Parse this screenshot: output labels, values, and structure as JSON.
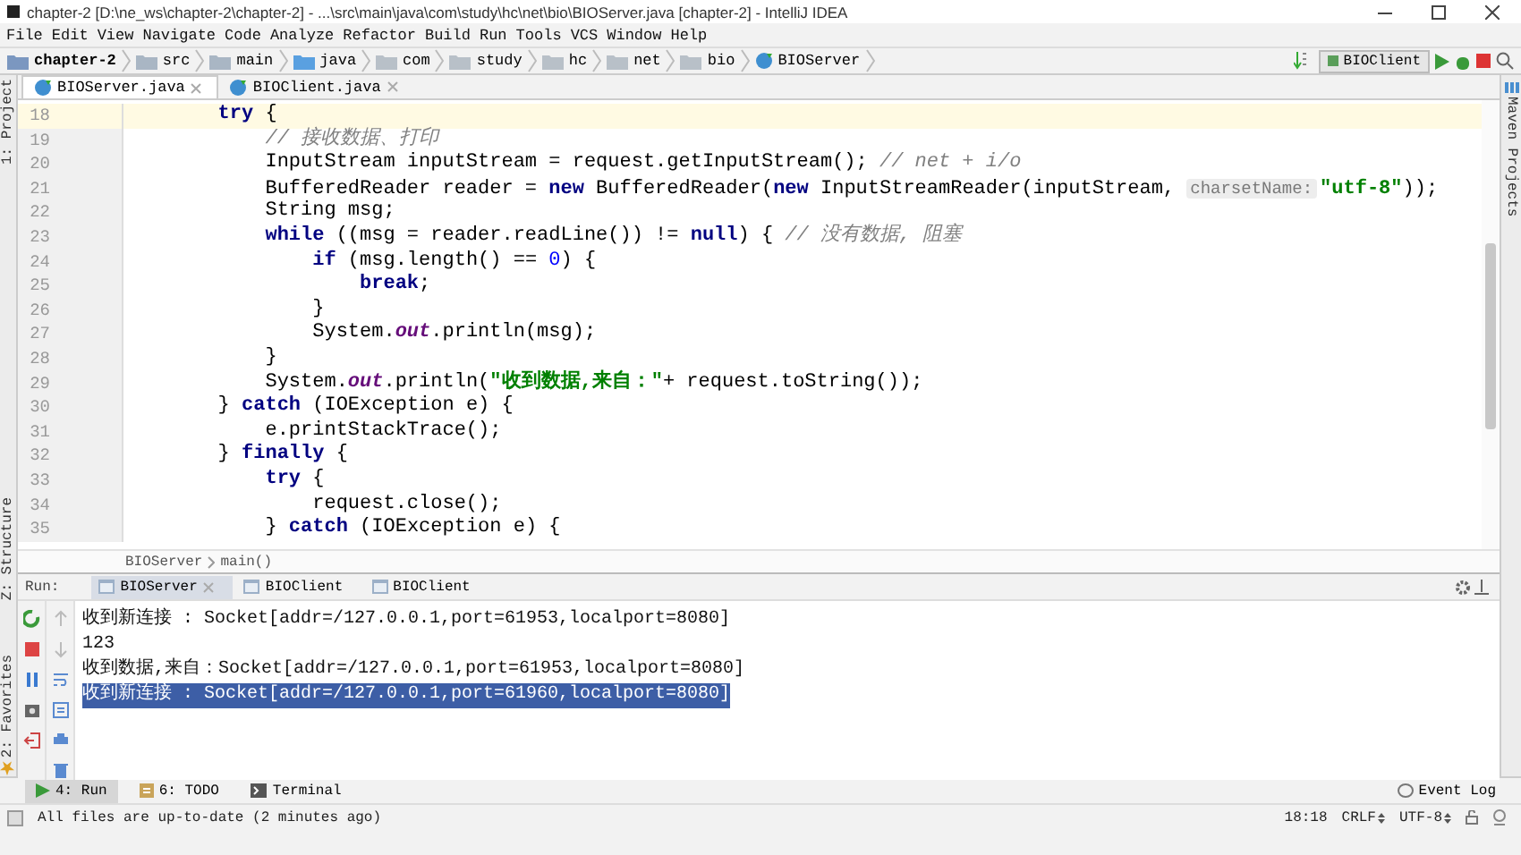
{
  "window": {
    "title": "chapter-2 [D:\\ne_ws\\chapter-2\\chapter-2] - ...\\src\\main\\java\\com\\study\\hc\\net\\bio\\BIOServer.java [chapter-2] - IntelliJ IDEA"
  },
  "menu": [
    "File",
    "Edit",
    "View",
    "Navigate",
    "Code",
    "Analyze",
    "Refactor",
    "Build",
    "Run",
    "Tools",
    "VCS",
    "Window",
    "Help"
  ],
  "nav": {
    "crumbs": [
      {
        "text": "chapter-2",
        "kind": "module"
      },
      {
        "text": "src",
        "kind": "folder"
      },
      {
        "text": "main",
        "kind": "folder"
      },
      {
        "text": "java",
        "kind": "source"
      },
      {
        "text": "com",
        "kind": "package"
      },
      {
        "text": "study",
        "kind": "package"
      },
      {
        "text": "hc",
        "kind": "package"
      },
      {
        "text": "net",
        "kind": "package"
      },
      {
        "text": "bio",
        "kind": "package"
      },
      {
        "text": "BIOServer",
        "kind": "class"
      }
    ],
    "run_config": "BIOClient"
  },
  "side_tools": {
    "left": [
      "1: Project",
      "Z: Structure",
      "2: Favorites"
    ],
    "right": [
      "Maven Projects"
    ]
  },
  "editor": {
    "tabs": [
      {
        "label": "BIOServer.java",
        "selected": true
      },
      {
        "label": "BIOClient.java",
        "selected": false
      }
    ],
    "lines": [
      {
        "number": "18",
        "current": true,
        "tokens": [
          {
            "kind": "kw",
            "text": "        try"
          },
          {
            "kind": "plain",
            "text": " {"
          }
        ]
      },
      {
        "number": "19",
        "current": false,
        "tokens": [
          {
            "kind": "com",
            "text": "            // 接收数据、打印"
          }
        ]
      },
      {
        "number": "20",
        "current": false,
        "tokens": [
          {
            "kind": "plain",
            "text": "            InputStream inputStream = request.getInputStream(); "
          },
          {
            "kind": "com",
            "text": "// net + i/o"
          }
        ]
      },
      {
        "number": "21",
        "current": false,
        "tokens": [
          {
            "kind": "plain",
            "text": "            BufferedReader reader = "
          },
          {
            "kind": "kw",
            "text": "new"
          },
          {
            "kind": "plain",
            "text": " BufferedReader("
          },
          {
            "kind": "kw",
            "text": "new"
          },
          {
            "kind": "plain",
            "text": " InputStreamReader(inputStream, "
          },
          {
            "kind": "hint",
            "text": "charsetName:"
          },
          {
            "kind": "str",
            "text": "\"utf-8\""
          },
          {
            "kind": "plain",
            "text": "));"
          }
        ]
      },
      {
        "number": "22",
        "current": false,
        "tokens": [
          {
            "kind": "plain",
            "text": "            String msg;"
          }
        ]
      },
      {
        "number": "23",
        "current": false,
        "tokens": [
          {
            "kind": "kw",
            "text": "            while"
          },
          {
            "kind": "plain",
            "text": " ((msg = reader.readLine()) != "
          },
          {
            "kind": "kw",
            "text": "null"
          },
          {
            "kind": "plain",
            "text": ") { "
          },
          {
            "kind": "com",
            "text": "// 没有数据, 阻塞"
          }
        ]
      },
      {
        "number": "24",
        "current": false,
        "tokens": [
          {
            "kind": "kw",
            "text": "                if"
          },
          {
            "kind": "plain",
            "text": " (msg.length() == "
          },
          {
            "kind": "num",
            "text": "0"
          },
          {
            "kind": "plain",
            "text": ") {"
          }
        ]
      },
      {
        "number": "25",
        "current": false,
        "tokens": [
          {
            "kind": "kw",
            "text": "                    break"
          },
          {
            "kind": "plain",
            "text": ";"
          }
        ]
      },
      {
        "number": "26",
        "current": false,
        "tokens": [
          {
            "kind": "plain",
            "text": "                }"
          }
        ]
      },
      {
        "number": "27",
        "current": false,
        "tokens": [
          {
            "kind": "plain",
            "text": "                System."
          },
          {
            "kind": "fld",
            "text": "out"
          },
          {
            "kind": "plain",
            "text": ".println(msg);"
          }
        ]
      },
      {
        "number": "28",
        "current": false,
        "tokens": [
          {
            "kind": "plain",
            "text": "            }"
          }
        ]
      },
      {
        "number": "29",
        "current": false,
        "tokens": [
          {
            "kind": "plain",
            "text": "            System."
          },
          {
            "kind": "fld",
            "text": "out"
          },
          {
            "kind": "plain",
            "text": ".println("
          },
          {
            "kind": "str",
            "text": "\"收到数据,来自：\""
          },
          {
            "kind": "plain",
            "text": "+ request.toString());"
          }
        ]
      },
      {
        "number": "30",
        "current": false,
        "tokens": [
          {
            "kind": "plain",
            "text": "        } "
          },
          {
            "kind": "kw",
            "text": "catch"
          },
          {
            "kind": "plain",
            "text": " (IOException e) {"
          }
        ]
      },
      {
        "number": "31",
        "current": false,
        "tokens": [
          {
            "kind": "plain",
            "text": "            e.printStackTrace();"
          }
        ]
      },
      {
        "number": "32",
        "current": false,
        "tokens": [
          {
            "kind": "plain",
            "text": "        } "
          },
          {
            "kind": "kw",
            "text": "finally"
          },
          {
            "kind": "plain",
            "text": " {"
          }
        ]
      },
      {
        "number": "33",
        "current": false,
        "tokens": [
          {
            "kind": "kw",
            "text": "            try"
          },
          {
            "kind": "plain",
            "text": " {"
          }
        ]
      },
      {
        "number": "34",
        "current": false,
        "tokens": [
          {
            "kind": "plain",
            "text": "                request.close();"
          }
        ]
      },
      {
        "number": "35",
        "current": false,
        "tokens": [
          {
            "kind": "plain",
            "text": "            } "
          },
          {
            "kind": "kw",
            "text": "catch"
          },
          {
            "kind": "plain",
            "text": " (IOException e) {"
          }
        ]
      }
    ],
    "breadcrumb": [
      "BIOServer",
      "main()"
    ]
  },
  "run": {
    "label": "Run:",
    "tabs": [
      {
        "label": "BIOServer",
        "selected": true
      },
      {
        "label": "BIOClient",
        "selected": false
      },
      {
        "label": "BIOClient",
        "selected": false
      }
    ],
    "output": [
      {
        "text": "收到新连接 : Socket[addr=/127.0.0.1,port=61953,localport=8080]",
        "selected": false
      },
      {
        "text": "123",
        "selected": false
      },
      {
        "text": "收到数据,来自：Socket[addr=/127.0.0.1,port=61953,localport=8080]",
        "selected": false
      },
      {
        "text": "收到新连接 : Socket[addr=/127.0.0.1,port=61960,localport=8080]",
        "selected": true
      }
    ]
  },
  "tool_tabs": [
    {
      "label": "4: Run",
      "selected": true
    },
    {
      "label": "6: TODO",
      "selected": false
    },
    {
      "label": "Terminal",
      "selected": false
    }
  ],
  "event_log": "Event Log",
  "status": {
    "message": "All files are up-to-date (2 minutes ago)",
    "position": "18:18",
    "line_separator": "CRLF",
    "encoding": "UTF-8"
  }
}
